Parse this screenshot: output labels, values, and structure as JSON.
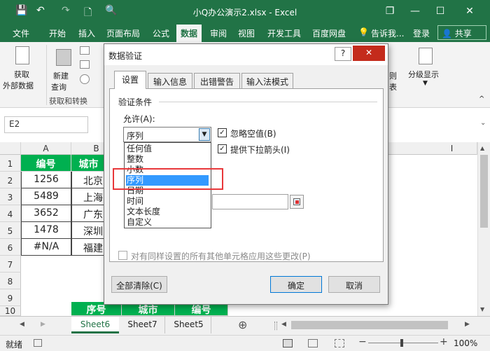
{
  "window": {
    "title": "小Q办公演示2.xlsx - Excel",
    "quick_access": {
      "save": "💾",
      "undo": "↶",
      "redo": "↷",
      "new": "🗋",
      "preview": "🔍"
    },
    "controls": {
      "restore": "❐",
      "minimize": "—",
      "maximize": "☐",
      "close": "✕"
    }
  },
  "ribbon": {
    "tabs": [
      {
        "label": "文件"
      },
      {
        "label": "开始"
      },
      {
        "label": "插入"
      },
      {
        "label": "页面布局"
      },
      {
        "label": "公式"
      },
      {
        "label": "数据"
      },
      {
        "label": "审阅"
      },
      {
        "label": "视图"
      },
      {
        "label": "开发工具"
      },
      {
        "label": "百度网盘"
      },
      {
        "label": "告诉我..."
      },
      {
        "label": "登录"
      }
    ],
    "share_label": "共享",
    "get_data_label1": "获取",
    "get_data_label2": "外部数据",
    "new_query_label1": "新建",
    "new_query_label2": "查询",
    "group_get_transform": "获取和转换",
    "outline_label": "分级显示",
    "partial_label1": "则",
    "partial_label2": "表"
  },
  "formula_bar": {
    "name_box": "E2",
    "fx": "fx"
  },
  "grid": {
    "columns": [
      "A",
      "B",
      "I"
    ],
    "rows": [
      "1",
      "2",
      "3",
      "4",
      "5",
      "6",
      "7",
      "8",
      "9",
      "10"
    ],
    "header_cells": [
      "编号",
      "城市"
    ],
    "values_a": [
      "1256",
      "5489",
      "3652",
      "1478",
      "#N/A"
    ],
    "values_b": [
      "北京",
      "上海",
      "广东",
      "深圳",
      "福建"
    ],
    "row10": [
      "序号",
      "城市",
      "编号"
    ]
  },
  "sheets": {
    "tabs": [
      "Sheet6",
      "Sheet7",
      "Sheet5"
    ],
    "add": "⊕"
  },
  "status": {
    "ready": "就绪",
    "zoom": "100%",
    "minus": "−",
    "plus": "+"
  },
  "dialog": {
    "title": "数据验证",
    "help": "?",
    "close": "✕",
    "tabs": [
      "设置",
      "输入信息",
      "出错警告",
      "输入法模式"
    ],
    "section": "验证条件",
    "allow_label": "允许(A):",
    "allow_value": "序列",
    "ignore_blank": "忽略空值(B)",
    "dropdown_arrow": "提供下拉箭头(I)",
    "options": [
      "任何值",
      "整数",
      "小数",
      "序列",
      "日期",
      "时间",
      "文本长度",
      "自定义"
    ],
    "selected_index": 3,
    "apply_all": "对有同样设置的所有其他单元格应用这些更改(P)",
    "clear_all": "全部清除(C)",
    "ok": "确定",
    "cancel": "取消"
  },
  "colors": {
    "excel_green": "#217346",
    "header_green": "#00b050",
    "selection_blue": "#3399ff",
    "highlight_red": "#e8373a"
  }
}
